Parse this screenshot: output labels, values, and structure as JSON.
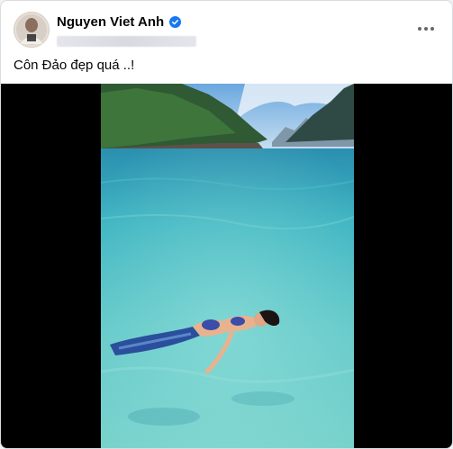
{
  "post": {
    "author_name": "Nguyen Viet Anh",
    "caption": "Côn Đảo đẹp quá ..!",
    "more_icon": "ellipsis-horizontal-icon",
    "verified_icon": "verified-badge-icon"
  },
  "colors": {
    "verified": "#1877f2",
    "text_primary": "#050505",
    "text_secondary": "#65676b"
  }
}
